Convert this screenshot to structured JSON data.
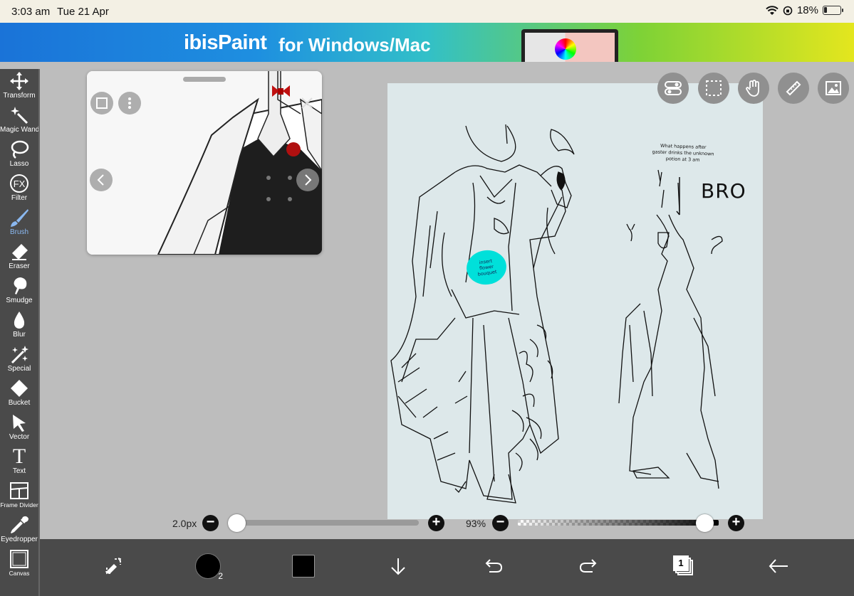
{
  "status_bar": {
    "time": "3:03 am",
    "date": "Tue 21 Apr",
    "battery_percent": "18%",
    "battery_level": 0.18
  },
  "banner": {
    "brand": "ibisPaint",
    "tagline": "for Windows/Mac"
  },
  "toolbar": {
    "tools": [
      {
        "name": "transform",
        "label": "Transform"
      },
      {
        "name": "magic-wand",
        "label": "Magic Wand"
      },
      {
        "name": "lasso",
        "label": "Lasso"
      },
      {
        "name": "filter",
        "label": "Filter",
        "icon_text": "FX"
      },
      {
        "name": "brush",
        "label": "Brush",
        "active": true
      },
      {
        "name": "eraser",
        "label": "Eraser"
      },
      {
        "name": "smudge",
        "label": "Smudge"
      },
      {
        "name": "blur",
        "label": "Blur"
      },
      {
        "name": "special",
        "label": "Special"
      },
      {
        "name": "bucket",
        "label": "Bucket"
      },
      {
        "name": "vector",
        "label": "Vector"
      },
      {
        "name": "text",
        "label": "Text",
        "icon_text": "T"
      },
      {
        "name": "frame-divider",
        "label": "Frame Divider"
      },
      {
        "name": "eyedropper",
        "label": "Eyedropper"
      },
      {
        "name": "canvas",
        "label": "Canvas"
      }
    ],
    "active_color": "#8ab8f0"
  },
  "canvas": {
    "sketch_text": {
      "note": [
        "What happens after",
        "gaster drinks the unknown",
        "potion at 3 am"
      ],
      "shout": "BRO",
      "bubble": [
        "insert",
        "flower",
        "bouquet"
      ]
    },
    "bubble_color": "#00e0da"
  },
  "sliders": {
    "brush_size": "2.0px",
    "opacity": "93%",
    "opacity_level": 0.93,
    "minus": "−",
    "plus": "+"
  },
  "bottom_bar": {
    "brush_badge": "2",
    "layer_count": "1",
    "icons": [
      "swap-tools-icon",
      "brush-preview-icon",
      "color-swatch-icon",
      "download-icon",
      "undo-icon",
      "redo-icon",
      "layers-icon",
      "back-arrow-icon"
    ]
  },
  "top_right_buttons": [
    "toggle-icon",
    "selection-icon",
    "hand-icon",
    "ruler-icon",
    "reference-image-icon"
  ]
}
